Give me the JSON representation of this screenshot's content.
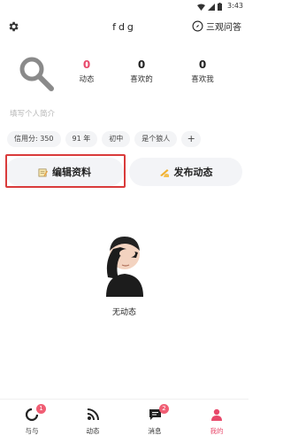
{
  "status_bar": {
    "time": "3:43"
  },
  "header": {
    "title": "fdg",
    "qa_label": "三观问答"
  },
  "profile": {
    "stats": [
      {
        "value": "0",
        "label": "动态",
        "highlight": true
      },
      {
        "value": "0",
        "label": "喜欢的",
        "highlight": false
      },
      {
        "value": "0",
        "label": "喜欢我",
        "highlight": false
      }
    ],
    "bio_placeholder": "填写个人简介",
    "tags": [
      "信用分: 350",
      "91 年",
      "初中",
      "是个狼人",
      "+"
    ]
  },
  "actions": {
    "edit_label": "编辑资料",
    "post_label": "发布动态"
  },
  "empty_state": {
    "text": "无动态"
  },
  "tabbar": {
    "items": [
      {
        "label": "与与",
        "badge": "1",
        "icon": "circle-refresh-icon"
      },
      {
        "label": "动态",
        "badge": "",
        "icon": "rss-icon"
      },
      {
        "label": "消息",
        "badge": "2",
        "icon": "chat-icon"
      },
      {
        "label": "我的",
        "badge": "",
        "icon": "person-icon",
        "active": true
      }
    ]
  },
  "colors": {
    "accent": "#e8496b",
    "highlight_box": "#d93b3b",
    "button_bg": "#f3f4f7"
  }
}
